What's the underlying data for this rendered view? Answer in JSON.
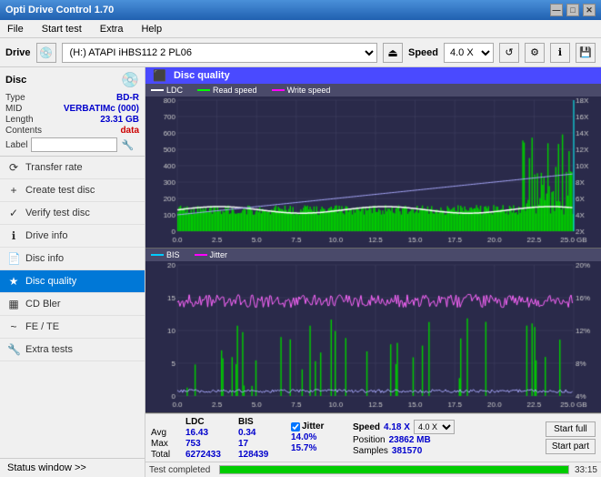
{
  "app": {
    "title": "Opti Drive Control 1.70",
    "title_buttons": [
      "—",
      "□",
      "✕"
    ]
  },
  "menu": {
    "items": [
      "File",
      "Start test",
      "Extra",
      "Help"
    ]
  },
  "drive_bar": {
    "label": "Drive",
    "drive_value": "(H:) ATAPI iHBS112  2 PL06",
    "speed_label": "Speed",
    "speed_value": "4.0 X"
  },
  "disc_panel": {
    "title": "Disc",
    "fields": [
      {
        "label": "Type",
        "value": "BD-R",
        "class": "blue"
      },
      {
        "label": "MID",
        "value": "VERBATIMc (000)",
        "class": "blue"
      },
      {
        "label": "Length",
        "value": "23.31 GB",
        "class": "blue"
      },
      {
        "label": "Contents",
        "value": "data",
        "class": "red"
      },
      {
        "label": "Label",
        "value": "",
        "class": "input"
      }
    ]
  },
  "nav": {
    "items": [
      {
        "label": "Transfer rate",
        "icon": "⟳",
        "active": false
      },
      {
        "label": "Create test disc",
        "icon": "💿",
        "active": false
      },
      {
        "label": "Verify test disc",
        "icon": "✓",
        "active": false
      },
      {
        "label": "Drive info",
        "icon": "ℹ",
        "active": false
      },
      {
        "label": "Disc info",
        "icon": "📄",
        "active": false
      },
      {
        "label": "Disc quality",
        "icon": "★",
        "active": true
      },
      {
        "label": "CD Bler",
        "icon": "📊",
        "active": false
      },
      {
        "label": "FE / TE",
        "icon": "~",
        "active": false
      },
      {
        "label": "Extra tests",
        "icon": "🔧",
        "active": false
      }
    ]
  },
  "status_window": {
    "label": "Status window >>"
  },
  "disc_quality": {
    "title": "Disc quality",
    "legend": {
      "ldc": "LDC",
      "read": "Read speed",
      "write": "Write speed"
    },
    "legend2": {
      "bis": "BIS",
      "jitter": "Jitter"
    },
    "chart1": {
      "y_max": 800,
      "y_labels": [
        "800",
        "700",
        "600",
        "500",
        "400",
        "300",
        "200",
        "100",
        "0"
      ],
      "y_right": [
        "18X",
        "16X",
        "14X",
        "12X",
        "10X",
        "8X",
        "6X",
        "4X",
        "2X"
      ],
      "x_labels": [
        "0.0",
        "2.5",
        "5.0",
        "7.5",
        "10.0",
        "12.5",
        "15.0",
        "17.5",
        "20.0",
        "22.5",
        "25.0 GB"
      ]
    },
    "chart2": {
      "y_max": 20,
      "y_labels": [
        "20",
        "15",
        "10",
        "5",
        "0"
      ],
      "y_right": [
        "20%",
        "16%",
        "12%",
        "8%",
        "4%"
      ],
      "x_labels": [
        "0.0",
        "2.5",
        "5.0",
        "7.5",
        "10.0",
        "12.5",
        "15.0",
        "17.5",
        "20.0",
        "22.5",
        "25.0 GB"
      ]
    }
  },
  "stats": {
    "headers": [
      "",
      "LDC",
      "BIS",
      "",
      "Jitter",
      "Speed",
      "",
      ""
    ],
    "avg": {
      "ldc": "16.43",
      "bis": "0.34",
      "jitter": "14.0%"
    },
    "max": {
      "ldc": "753",
      "bis": "17",
      "jitter": "15.7%"
    },
    "total": {
      "ldc": "6272433",
      "bis": "128439"
    },
    "speed_label": "Speed",
    "speed_value": "4.18 X",
    "speed_select": "4.0 X",
    "position_label": "Position",
    "position_value": "23862 MB",
    "samples_label": "Samples",
    "samples_value": "381570",
    "start_full": "Start full",
    "start_part": "Start part",
    "jitter_checked": true
  },
  "progress": {
    "status": "Test completed",
    "percent": 100,
    "time": "33:15"
  },
  "colors": {
    "accent_blue": "#0078d7",
    "nav_active_bg": "#0078d7",
    "chart_bg": "#2a2a4a",
    "ldc_line": "#ffffff",
    "read_line": "#00ff00",
    "bis_line": "#ff00ff",
    "jitter_line": "#ff00ff"
  }
}
